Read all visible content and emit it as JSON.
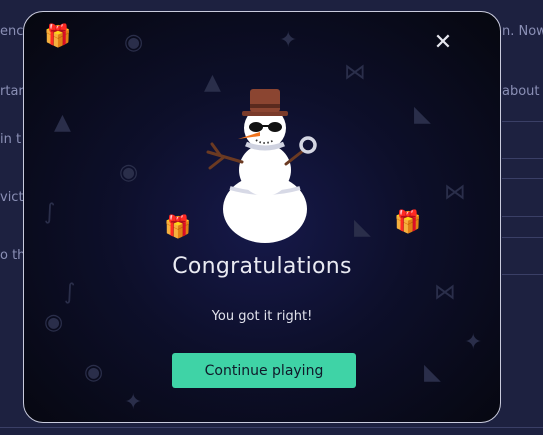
{
  "background": {
    "fragments": [
      "ence",
      "rtar",
      "in t",
      "vict",
      "o th",
      "n. Now",
      "about"
    ]
  },
  "modal": {
    "close_symbol": "✕",
    "title": "Congratulations",
    "message": "You got it right!",
    "continue_label": "Continue playing",
    "accent_color": "#3fd3a6"
  }
}
